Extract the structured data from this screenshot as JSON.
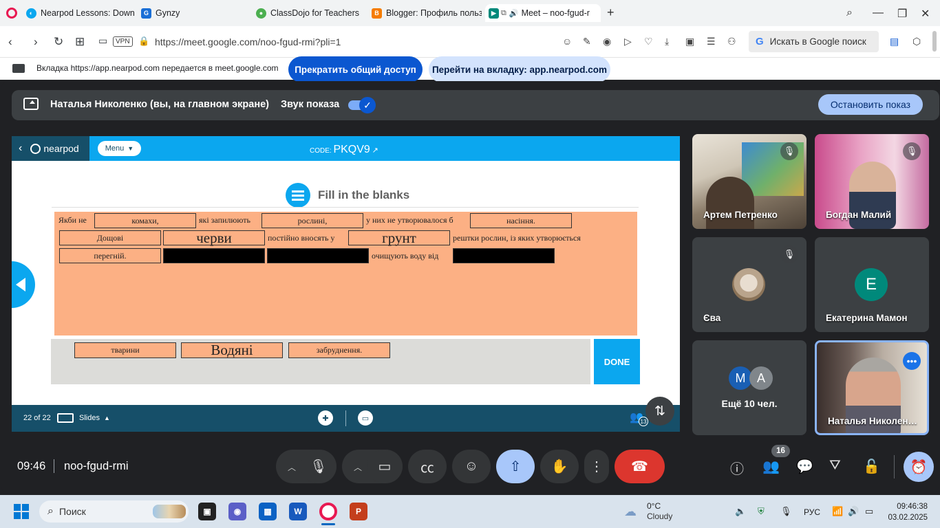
{
  "browser": {
    "tabs": [
      {
        "label": "Nearpod Lessons: Downlo",
        "color": "#0ba7ef"
      },
      {
        "label": "Gynzy",
        "color": "#1a6fd6"
      },
      {
        "label": "ClassDojo for Teachers",
        "color": "#4caf50"
      },
      {
        "label": "Blogger: Профиль польз",
        "color": "#f57c00"
      },
      {
        "label": "Meet – noo-fgud-r",
        "color": "#00897b"
      }
    ],
    "url": "https://meet.google.com/noo-fgud-rmi?pli=1",
    "vpn_badge": "VPN",
    "search_placeholder": "Искать в Google поиск"
  },
  "share_banner": {
    "text": "Вкладка https://app.nearpod.com передается в meet.google.com",
    "stop_sharing": "Прекратить общий доступ",
    "go_to_tab": "Перейти на вкладку: app.nearpod.com"
  },
  "presentation_bar": {
    "presenter": "Наталья Николенко (вы, на главном экране)",
    "sound_label": "Звук показа",
    "sound_on": true,
    "stop_button": "Остановить показ"
  },
  "nearpod": {
    "logo": "nearpod",
    "menu": "Menu",
    "code_label": "CODE:",
    "code": "PKQV9",
    "activity_title": "Fill in the blanks",
    "sentence_text": [
      "Якби не",
      "які запилюють",
      "у них не утворювалося б",
      "постійно вносять у",
      "рештки рослин, із яких утворюється",
      "очищують воду від"
    ],
    "placed_answers": [
      "комахи,",
      "рослині,",
      "насіння.",
      "Дощові",
      "черви",
      "грунт",
      "перегній."
    ],
    "word_bank": [
      "тварини",
      "Водяні",
      "забруднення."
    ],
    "done": "DONE",
    "footer": {
      "slide_counter": "22 of 22",
      "slides_label": "Slides",
      "students_badge": "13"
    }
  },
  "participants": [
    {
      "name": "Артем Петренко",
      "muted": true
    },
    {
      "name": "Богдан Малий",
      "muted": true
    },
    {
      "name": "Єва",
      "muted": true
    },
    {
      "name": "Екатерина Мамон",
      "initial": "Е",
      "avatar_color": "#00897b"
    },
    {
      "name": "Ещё 10 чел.",
      "initials": [
        "М",
        "А"
      ]
    },
    {
      "name": "Наталья Николен…",
      "active_speaker": true
    }
  ],
  "controls": {
    "time": "09:46",
    "meeting_code": "noo-fgud-rmi",
    "participants_count": "16"
  },
  "taskbar": {
    "search_placeholder": "Поиск",
    "temperature": "0°C",
    "weather": "Cloudy",
    "language": "РУС",
    "time": "09:46:38",
    "date": "03.02.2025"
  }
}
